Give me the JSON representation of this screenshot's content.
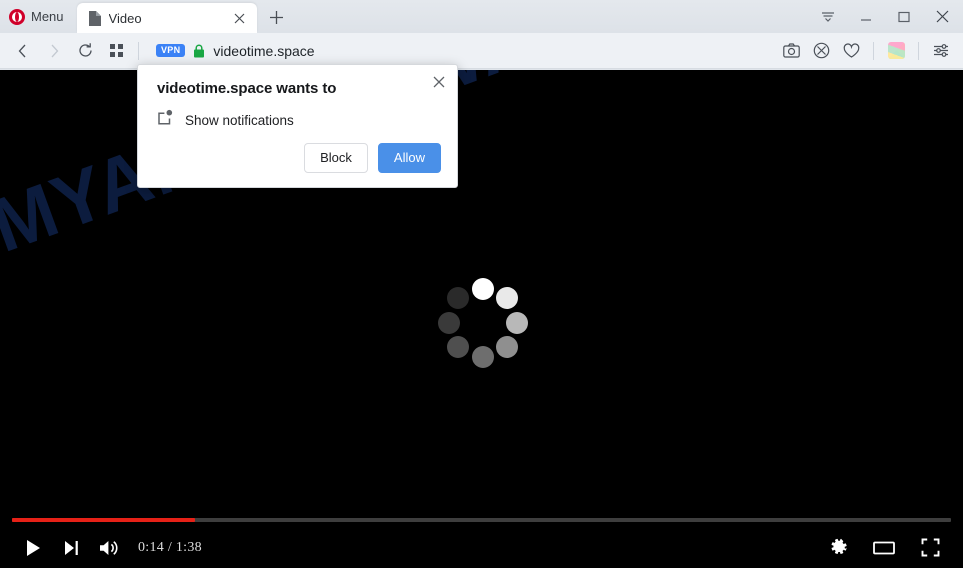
{
  "browser": {
    "name": "Opera",
    "menu_label": "Menu",
    "tabs": [
      {
        "title": "Video",
        "favicon": "page-icon",
        "active": true
      }
    ],
    "newtab_label": "+",
    "window_controls": [
      "tab-list-icon",
      "minimize-icon",
      "maximize-icon",
      "close-icon"
    ],
    "nav": {
      "back": "back-arrow-icon",
      "forward": "forward-arrow-icon",
      "reload": "reload-icon",
      "speeddial": "grid-icon"
    },
    "address": {
      "vpn_badge": "VPN",
      "security": "lock-icon",
      "url": "videotime.space"
    },
    "toolbar_right": [
      "snapshot-icon",
      "ad-blocker-icon",
      "heart-icon",
      "extension-cube-icon",
      "easy-setup-icon"
    ]
  },
  "page": {
    "watermark": "MYANTISPYWARE.COM",
    "watermark_color": "#0c1c3e",
    "background_color": "#000000",
    "spinner": {
      "name": "loading-spinner",
      "dot_count": 8,
      "dot_shades": [
        "#ffffff",
        "#e9e9e9",
        "#b8b8b8",
        "#8f8f8f",
        "#6e6e6e",
        "#4f4f4f",
        "#3a3a3a",
        "#2a2a2a"
      ]
    }
  },
  "player": {
    "progress_percent": 19.5,
    "progress_color": "#e62117",
    "track_color": "#3e3e3e",
    "current_time": "0:14",
    "duration": "1:38",
    "time_display": "0:14 / 1:38",
    "left_controls": [
      "play-icon",
      "next-track-icon",
      "volume-icon"
    ],
    "right_controls": [
      "settings-gear-icon",
      "theater-mode-icon",
      "fullscreen-icon"
    ]
  },
  "dialog": {
    "title": "videotime.space wants to",
    "permission_icon": "notification-icon",
    "permission_label": "Show notifications",
    "close_label": "×",
    "block_label": "Block",
    "allow_label": "Allow",
    "allow_color": "#4a90e8"
  }
}
